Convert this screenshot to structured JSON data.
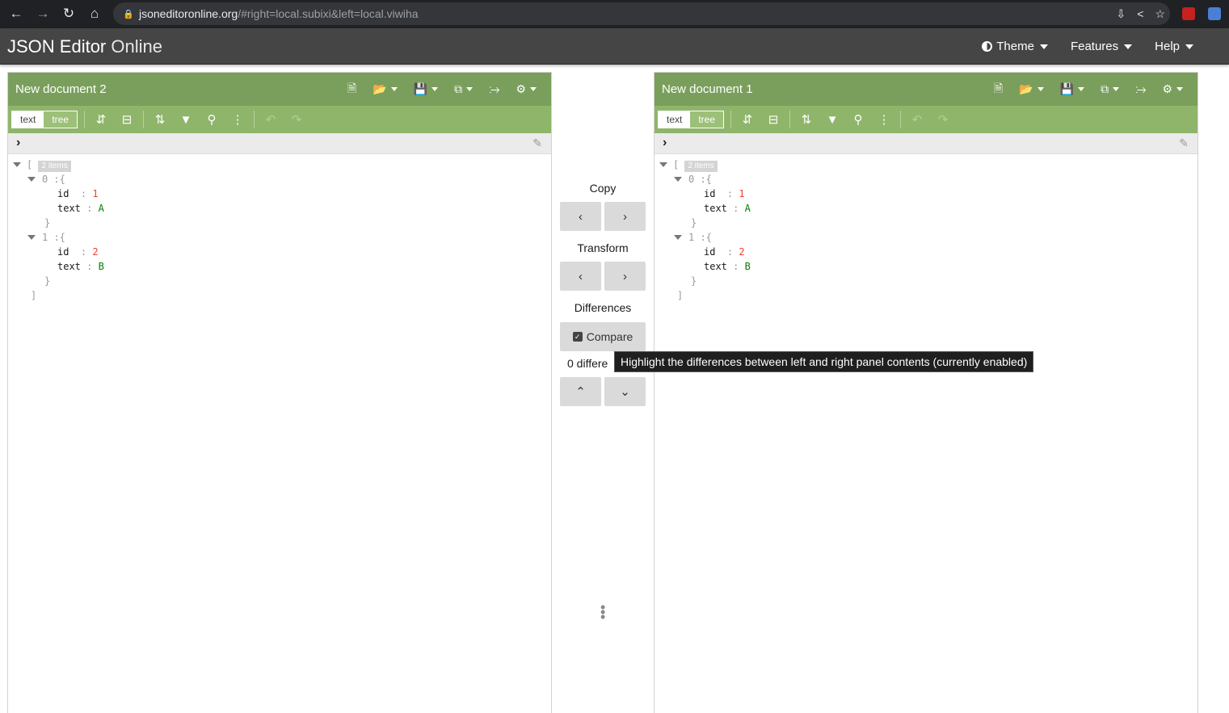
{
  "browser": {
    "url_host": "jsoneditoronline.org",
    "url_path": "/#right=local.subixi&left=local.viwiha"
  },
  "app": {
    "title_bold": "JSON Editor",
    "title_light": "Online",
    "menu": {
      "theme": "Theme",
      "features": "Features",
      "help": "Help"
    }
  },
  "left_panel": {
    "title": "New document 2",
    "mode_text": "text",
    "mode_tree": "tree",
    "tree": {
      "open_bracket": "[",
      "count_badge": "2 items",
      "items": [
        {
          "index": "0",
          "fields": [
            {
              "key": "id",
              "value": "1"
            },
            {
              "key": "text",
              "value": "A"
            }
          ]
        },
        {
          "index": "1",
          "fields": [
            {
              "key": "id",
              "value": "2"
            },
            {
              "key": "text",
              "value": "B"
            }
          ]
        }
      ],
      "close_bracket": "]"
    }
  },
  "right_panel": {
    "title": "New document 1",
    "mode_text": "text",
    "mode_tree": "tree",
    "tree": {
      "open_bracket": "[",
      "count_badge": "2 items",
      "items": [
        {
          "index": "0",
          "fields": [
            {
              "key": "id",
              "value": "1"
            },
            {
              "key": "text",
              "value": "A"
            }
          ]
        },
        {
          "index": "1",
          "fields": [
            {
              "key": "id",
              "value": "2"
            },
            {
              "key": "text",
              "value": "B"
            }
          ]
        }
      ],
      "close_bracket": "]"
    }
  },
  "middle": {
    "copy_label": "Copy",
    "transform_label": "Transform",
    "differences_label": "Differences",
    "compare_label": "Compare",
    "diff_count_text": "0 differe"
  },
  "tooltip": {
    "text": "Highlight the differences between left and right panel contents (currently enabled)"
  },
  "colors": {
    "panel_title_bg": "#7a9f5c",
    "toolbar_bg": "#8fb56b",
    "header_bg": "#454545",
    "number_value": "#ee422e",
    "string_value": "#008000"
  }
}
